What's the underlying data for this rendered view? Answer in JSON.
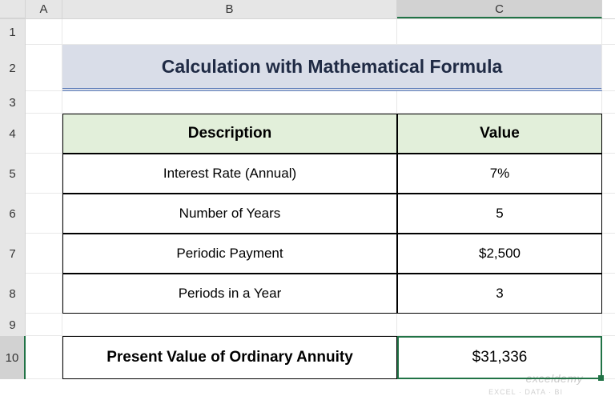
{
  "columns": {
    "A": "A",
    "B": "B",
    "C": "C"
  },
  "rows": {
    "1": "1",
    "2": "2",
    "3": "3",
    "4": "4",
    "5": "5",
    "6": "6",
    "7": "7",
    "8": "8",
    "9": "9",
    "10": "10"
  },
  "title": "Calculation with Mathematical Formula",
  "table": {
    "headers": {
      "description": "Description",
      "value": "Value"
    },
    "rows": [
      {
        "desc": "Interest Rate (Annual)",
        "val": "7%"
      },
      {
        "desc": "Number of Years",
        "val": "5"
      },
      {
        "desc": "Periodic Payment",
        "val": "$2,500"
      },
      {
        "desc": "Periods in a Year",
        "val": "3"
      }
    ]
  },
  "result": {
    "label": "Present Value of Ordinary Annuity",
    "value": "$31,336"
  },
  "watermark": {
    "main": "exceldemy",
    "sub": "EXCEL · DATA · BI"
  },
  "active_cell": "C10"
}
